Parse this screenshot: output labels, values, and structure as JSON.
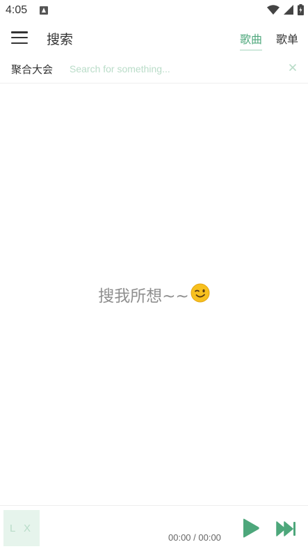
{
  "status_bar": {
    "time": "4:05"
  },
  "header": {
    "title": "搜索",
    "tabs": [
      {
        "label": "歌曲",
        "active": true
      },
      {
        "label": "歌单",
        "active": false
      }
    ]
  },
  "search": {
    "source": "聚合大会",
    "placeholder": "Search for something..."
  },
  "empty_state": {
    "text": "搜我所想~~"
  },
  "player": {
    "cover_text": "L X",
    "time": "00:00 / 00:00"
  },
  "colors": {
    "accent": "#4da77b",
    "accent_light": "#cfe8dc",
    "placeholder": "#b9dcc8"
  }
}
